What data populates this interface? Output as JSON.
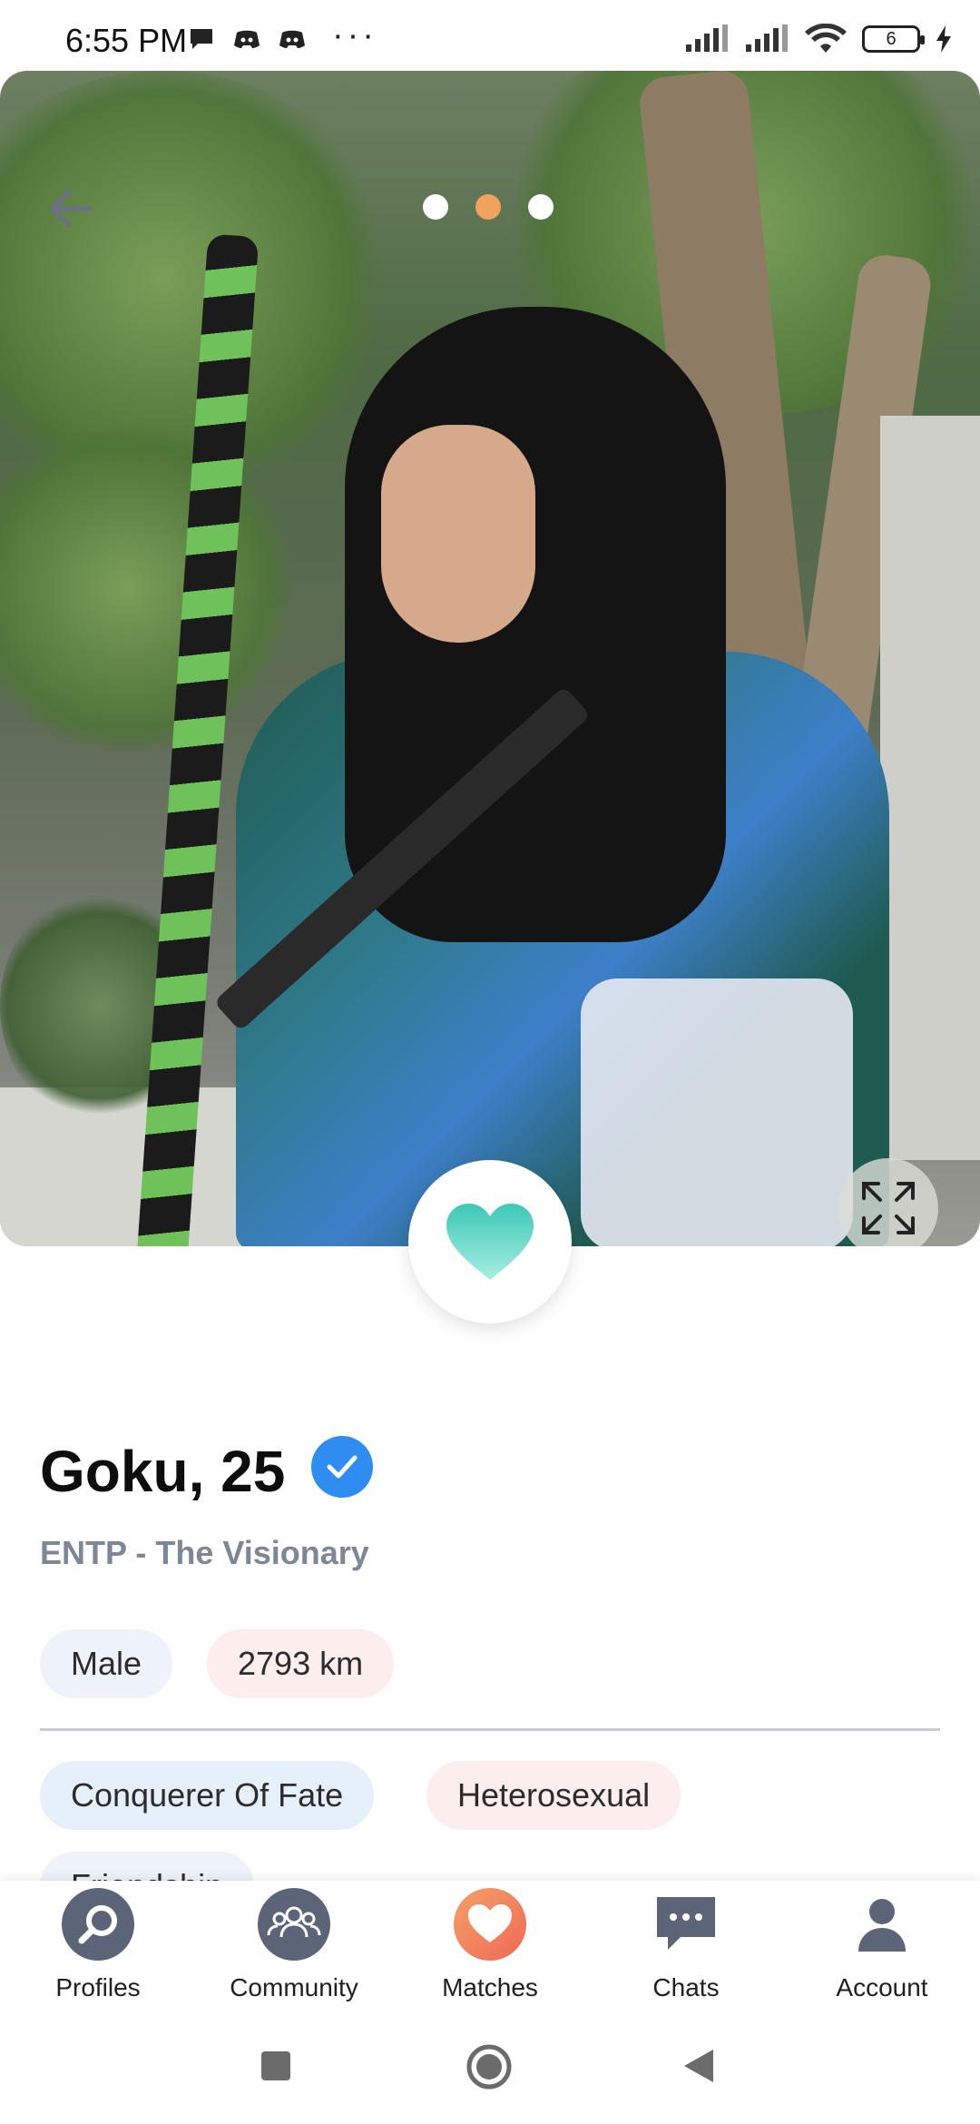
{
  "status_bar": {
    "time": "6:55 PM",
    "more": "···",
    "battery": "6"
  },
  "photo": {
    "pager_dots": 3,
    "active_dot": 1,
    "colors": {
      "dot_active": "#f1a35e",
      "dot_inactive": "#ffffff"
    }
  },
  "profile": {
    "name": "Goku, 25",
    "subtitle": "ENTP - The Visionary",
    "gender": "Male",
    "distance": "2793  km",
    "tags": [
      "Conquerer Of Fate",
      "Heterosexual",
      "Friendship"
    ]
  },
  "nav": {
    "items": [
      {
        "label": "Profiles",
        "icon": "search-icon"
      },
      {
        "label": "Community",
        "icon": "group-icon"
      },
      {
        "label": "Matches",
        "icon": "heart-icon"
      },
      {
        "label": "Chats",
        "icon": "chat-icon"
      },
      {
        "label": "Account",
        "icon": "person-icon"
      }
    ],
    "colors": {
      "icon": "#5b6577",
      "matches_accent": "#f2775b"
    }
  },
  "colors": {
    "verify": "#2f8cf0",
    "subtitle": "#7d8797",
    "heart_gradient_top": "#4ad0c0",
    "heart_gradient_bottom": "#8be8d8"
  }
}
